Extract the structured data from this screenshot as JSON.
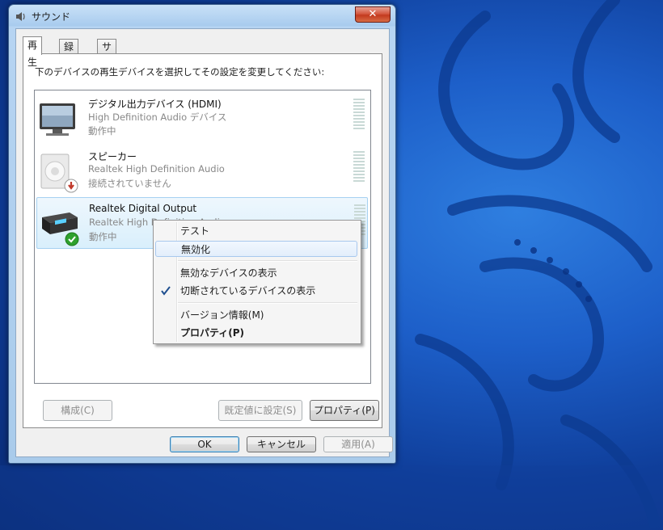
{
  "window": {
    "title": "サウンド",
    "close_glyph": "✕"
  },
  "tabs": [
    {
      "label": "再生",
      "active": true
    },
    {
      "label": "録音",
      "active": false
    },
    {
      "label": "サウンド",
      "active": false
    }
  ],
  "instruction": "下のデバイスの再生デバイスを選択してその設定を変更してください:",
  "devices": [
    {
      "name": "デジタル出力デバイス (HDMI)",
      "description": "High Definition Audio デバイス",
      "status": "動作中",
      "icon": "monitor-icon"
    },
    {
      "name": "スピーカー",
      "description": "Realtek High Definition Audio",
      "status": "接続されていません",
      "icon": "speaker-icon",
      "badge": "unplugged-badge-icon"
    },
    {
      "name": "Realtek Digital Output",
      "description": "Realtek High Definition Audio",
      "status": "動作中",
      "icon": "digital-output-icon",
      "badge": "default-device-check-icon",
      "selected": true
    }
  ],
  "buttons": {
    "configure": "構成(C)",
    "set_default": "既定値に設定(S)",
    "properties": "プロパティ(P)",
    "ok": "OK",
    "cancel": "キャンセル",
    "apply": "適用(A)"
  },
  "context_menu": {
    "items": [
      {
        "label": "テスト"
      },
      {
        "label": "無効化",
        "hover": true
      },
      {
        "label": "無効なデバイスの表示"
      },
      {
        "label": "切断されているデバイスの表示",
        "checked": true
      },
      {
        "label": "バージョン情報(M)"
      },
      {
        "label": "プロパティ(P)",
        "bold": true
      }
    ]
  },
  "colors": {
    "accent": "#3c7fb1",
    "wallpaper": "#1d5fc9",
    "ok_check": "#2ea12e",
    "unplugged": "#c0392b"
  }
}
